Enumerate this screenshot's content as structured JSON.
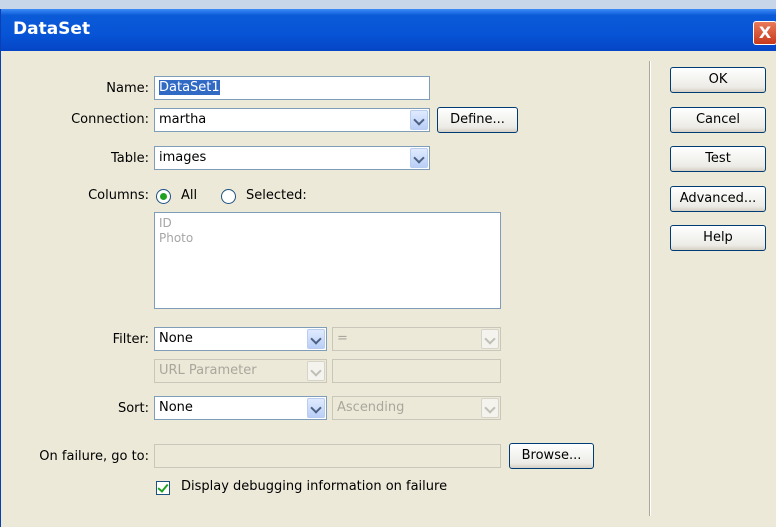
{
  "window": {
    "title": "DataSet",
    "close_label": "X"
  },
  "form": {
    "name_label": "Name:",
    "name_value": "DataSet1",
    "connection_label": "Connection:",
    "connection_value": "martha",
    "define_button": "Define...",
    "table_label": "Table:",
    "table_value": "images",
    "columns_label": "Columns:",
    "columns_all": "All",
    "columns_selected": "Selected:",
    "columns_list": [
      "ID",
      "Photo"
    ],
    "filter_label": "Filter:",
    "filter_value": "None",
    "filter_operator": "=",
    "filter_source": "URL Parameter",
    "filter_value_text": "",
    "sort_label": "Sort:",
    "sort_value": "None",
    "sort_order": "Ascending",
    "failure_label": "On failure, go to:",
    "failure_value": "",
    "browse_button": "Browse...",
    "debug_label": "Display debugging information on failure",
    "debug_checked": true
  },
  "buttons": {
    "ok": "OK",
    "cancel": "Cancel",
    "test": "Test",
    "advanced": "Advanced...",
    "help": "Help"
  },
  "colors": {
    "titlebar": "#0754d6",
    "dialog_bg": "#ece9d8",
    "check_green": "#21a121"
  }
}
